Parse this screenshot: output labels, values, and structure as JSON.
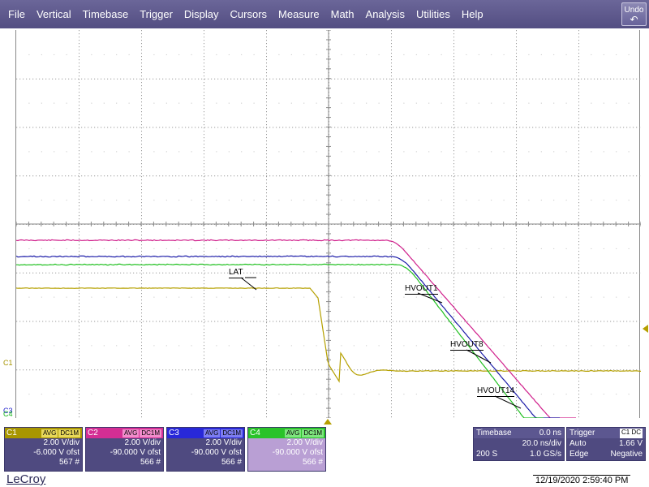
{
  "menu": {
    "items": [
      "File",
      "Vertical",
      "Timebase",
      "Trigger",
      "Display",
      "Cursors",
      "Measure",
      "Math",
      "Analysis",
      "Utilities",
      "Help"
    ],
    "undo_label": "Undo"
  },
  "markers": {
    "c1": "C1",
    "c3": "C3",
    "c4": "C4"
  },
  "trace_labels": {
    "lat": "LAT",
    "hvout1": "HVOUT1",
    "hvout8": "HVOUT8",
    "hvout14": "HVOUT14"
  },
  "channels": [
    {
      "name": "C1",
      "tag1": "AVG",
      "tag2": "DC1M",
      "scale": "2.00 V/div",
      "offset": "-6.000 V ofst",
      "count": "567 #",
      "color": "#b0a000"
    },
    {
      "name": "C2",
      "tag1": "AVG",
      "tag2": "DC1M",
      "scale": "2.00 V/div",
      "offset": "-90.000 V ofst",
      "count": "566 #",
      "color": "#e0309a"
    },
    {
      "name": "C3",
      "tag1": "AVG",
      "tag2": "DC1M",
      "scale": "2.00 V/div",
      "offset": "-90.000 V ofst",
      "count": "566 #",
      "color": "#2828d8"
    },
    {
      "name": "C4",
      "tag1": "AVG",
      "tag2": "DC1M",
      "scale": "2.00 V/div",
      "offset": "-90.000 V ofst",
      "count": "566 #",
      "color": "#20c020"
    }
  ],
  "timebase": {
    "label": "Timebase",
    "delay": "0.0 ns",
    "scale": "20.0 ns/div",
    "samples": "200 S",
    "rate": "1.0 GS/s"
  },
  "trigger": {
    "label": "Trigger",
    "source": "C1 DC",
    "mode": "Auto",
    "level": "1.66 V",
    "type": "Edge",
    "slope": "Negative"
  },
  "footer": {
    "brand": "LeCroy",
    "datetime": "12/19/2020 2:59:40 PM"
  },
  "trace_colors": {
    "c1": "#b5a000",
    "c2": "#d0208c",
    "c3": "#1c1ca8",
    "c4": "#20c020"
  }
}
